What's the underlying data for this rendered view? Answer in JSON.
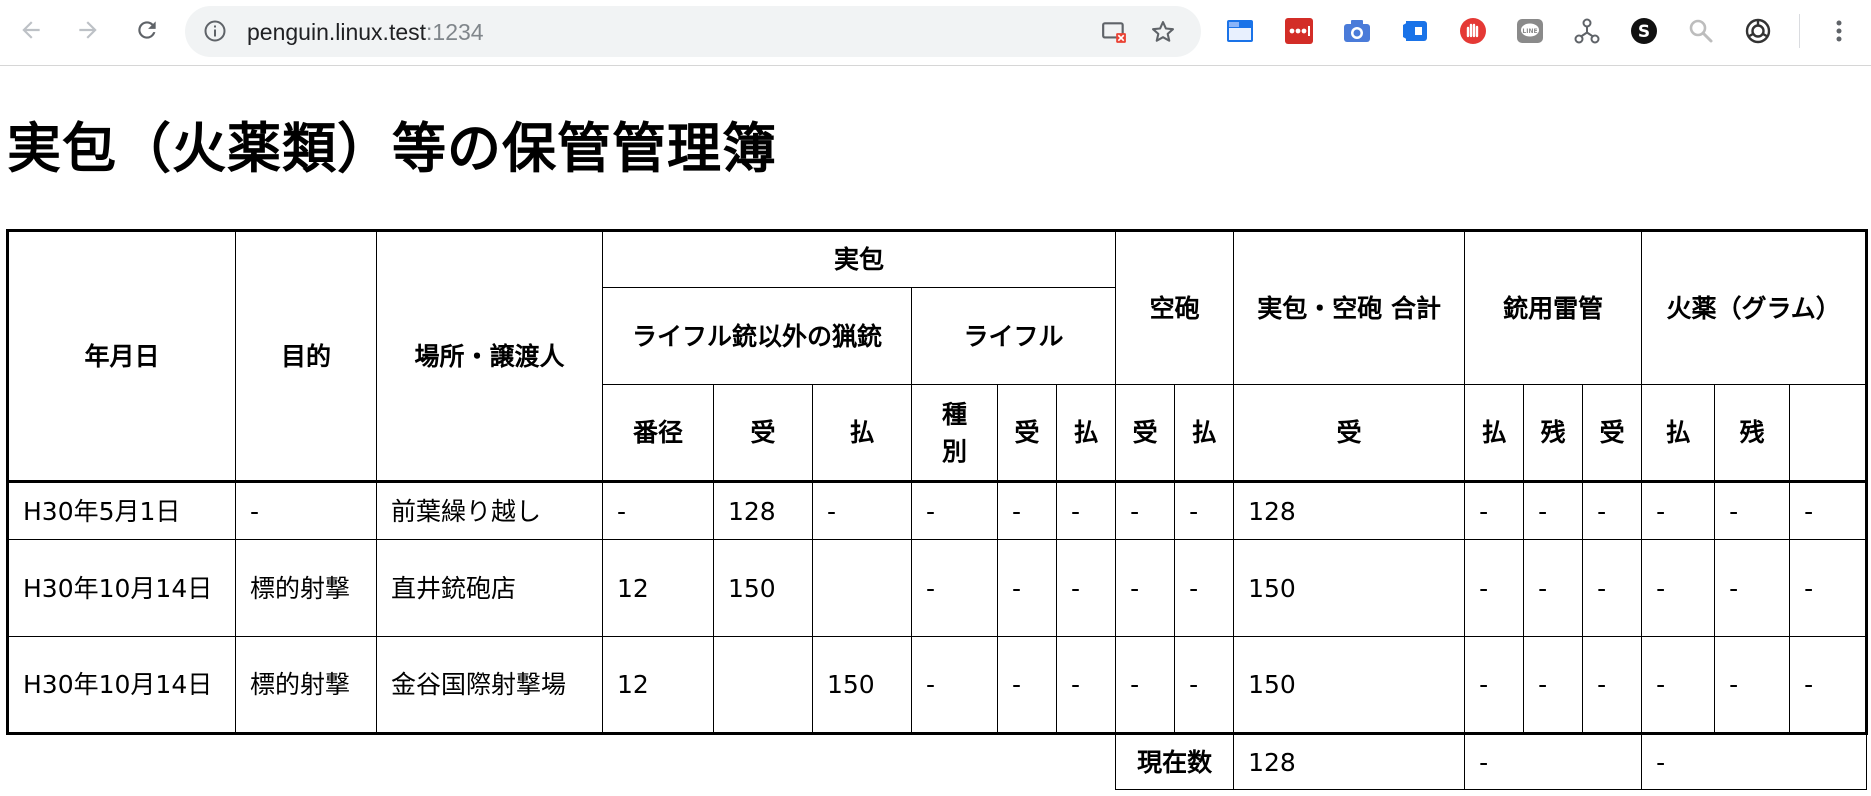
{
  "browser": {
    "url_host": "penguin.linux.test",
    "url_port": ":1234",
    "extensions": [
      "cast-off-icon",
      "bookmark-star-icon",
      "screen-split-icon",
      "lastpass-icon",
      "camera-icon",
      "tab-icon",
      "hand-icon",
      "line-icon",
      "network-icon",
      "s-icon",
      "search-icon",
      "chatgpt-icon"
    ],
    "colors": {
      "toolbar_bg": "#ffffff",
      "omnibox_bg": "#f1f3f4",
      "icon_grey": "#5f6368",
      "url_text": "#202124",
      "port_text": "#80868b"
    }
  },
  "page": {
    "title": "実包（火薬類）等の保管管理簿"
  },
  "table": {
    "header": {
      "date": "年月日",
      "purpose": "目的",
      "place": "場所・譲渡人",
      "cartridge": "実包",
      "shotgun": "ライフル銃以外の猟銃",
      "rifle": "ライフル",
      "blank": "空砲",
      "total": "実包・空砲 合計",
      "primer": "銃用雷管",
      "powder": "火薬（グラム）",
      "gauge": "番径",
      "recv": "受",
      "pay": "払",
      "kind": "種別",
      "balance": "残"
    },
    "rows": [
      {
        "date": "H30年5月1日",
        "purpose": "-",
        "place": "前葉繰り越し",
        "sg_gauge": "-",
        "sg_recv": "128",
        "sg_pay": "-",
        "rf_kind": "-",
        "rf_recv": "-",
        "rf_pay": "-",
        "bl_recv": "-",
        "bl_pay": "-",
        "total": "128",
        "pr_recv": "-",
        "pr_pay": "-",
        "pr_bal": "-",
        "pw_recv": "-",
        "pw_pay": "-",
        "pw_bal": "-"
      },
      {
        "date": "H30年10月14日",
        "purpose": "標的射撃",
        "place": "直井銃砲店",
        "sg_gauge": "12",
        "sg_recv": "150",
        "sg_pay": "",
        "rf_kind": "-",
        "rf_recv": "-",
        "rf_pay": "-",
        "bl_recv": "-",
        "bl_pay": "-",
        "total": "150",
        "pr_recv": "-",
        "pr_pay": "-",
        "pr_bal": "-",
        "pw_recv": "-",
        "pw_pay": "-",
        "pw_bal": "-"
      },
      {
        "date": "H30年10月14日",
        "purpose": "標的射撃",
        "place": "金谷国際射撃場",
        "sg_gauge": "12",
        "sg_recv": "",
        "sg_pay": "150",
        "rf_kind": "-",
        "rf_recv": "-",
        "rf_pay": "-",
        "bl_recv": "-",
        "bl_pay": "-",
        "total": "150",
        "pr_recv": "-",
        "pr_pay": "-",
        "pr_bal": "-",
        "pw_recv": "-",
        "pw_pay": "-",
        "pw_bal": "-"
      }
    ],
    "footer": {
      "label": "現在数",
      "total": "128",
      "primer": "-",
      "powder": "-"
    }
  }
}
